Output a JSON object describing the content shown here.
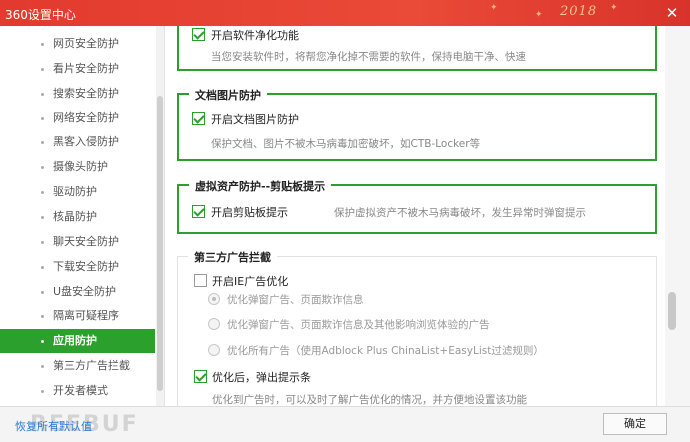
{
  "window": {
    "title": "360设置中心",
    "decoration_text": "2018",
    "close_glyph": "✕"
  },
  "sidebar": {
    "items": [
      {
        "label": "网页安全防护",
        "active": false
      },
      {
        "label": "看片安全防护",
        "active": false
      },
      {
        "label": "搜索安全防护",
        "active": false
      },
      {
        "label": "网络安全防护",
        "active": false
      },
      {
        "label": "黑客入侵防护",
        "active": false
      },
      {
        "label": "摄像头防护",
        "active": false
      },
      {
        "label": "驱动防护",
        "active": false
      },
      {
        "label": "核晶防护",
        "active": false
      },
      {
        "label": "聊天安全防护",
        "active": false
      },
      {
        "label": "下载安全防护",
        "active": false
      },
      {
        "label": "U盘安全防护",
        "active": false
      },
      {
        "label": "隔离可疑程序",
        "active": false
      },
      {
        "label": "应用防护",
        "active": true
      },
      {
        "label": "第三方广告拦截",
        "active": false
      },
      {
        "label": "开发者模式",
        "active": false
      }
    ]
  },
  "content": {
    "software_purify": {
      "checkbox_label": "开启软件净化功能",
      "checked": true,
      "description": "当您安装软件时，将帮您净化掉不需要的软件，保持电脑干净、快速"
    },
    "doc_image": {
      "title": "文档图片防护",
      "checkbox_label": "开启文档图片防护",
      "checked": true,
      "description": "保护文档、图片不被木马病毒加密破坏，如CTB-Locker等"
    },
    "virtual_asset": {
      "title": "虚拟资产防护--剪贴板提示",
      "checkbox_label": "开启剪贴板提示",
      "checked": true,
      "description": "保护虚拟资产不被木马病毒破坏，发生异常时弹窗提示"
    },
    "ad_block": {
      "title": "第三方广告拦截",
      "ie_checkbox_label": "开启IE广告优化",
      "ie_checked": false,
      "options": [
        {
          "label": "优化弹窗广告、页面欺诈信息",
          "selected": true
        },
        {
          "label": "优化弹窗广告、页面欺诈信息及其他影响浏览体验的广告",
          "selected": false
        },
        {
          "label": "优化所有广告（使用Adblock Plus ChinaList+EasyList过滤规则）",
          "selected": false
        }
      ],
      "notify_checkbox_label": "优化后，弹出提示条",
      "notify_checked": true,
      "notify_description": "优化到广告时，可以及时了解广告优化的情况，并方便地设置该功能"
    }
  },
  "footer": {
    "restore_label": "恢复所有默认值",
    "watermark": "REEBUF",
    "ok_label": "确定"
  }
}
